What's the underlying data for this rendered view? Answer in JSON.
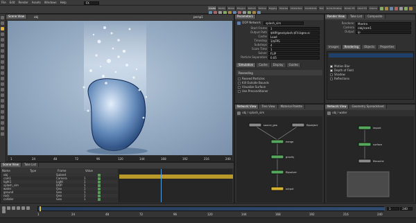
{
  "menu": {
    "items": [
      "File",
      "Edit",
      "Render",
      "Assets",
      "Windows",
      "Help"
    ],
    "desktop": "FX",
    "scene_view_tab": "Scene View",
    "tool_shelf_tabs": [
      "Create",
      "Modify",
      "Model",
      "Polygon",
      "Deform",
      "Texture",
      "Rigging",
      "Muscles",
      "Characters",
      "Constraints",
      "Hair",
      "Guide Brushes",
      "Terrain FX",
      "Cloud FX",
      "Volume"
    ]
  },
  "viewport": {
    "tab_label": "Scene View",
    "path": "obj",
    "camera_label": "persp1",
    "timeline_marks": [
      "1",
      "24",
      "48",
      "72",
      "96",
      "120",
      "144",
      "168",
      "192",
      "216",
      "240"
    ]
  },
  "parameters": {
    "tabs": [
      "Parameters"
    ],
    "node_label": "DOP Network",
    "node_name": "splash_sim",
    "fields": [
      {
        "label": "Start Frame",
        "value": "1"
      },
      {
        "label": "Output Path",
        "value": "$HIP/geo/splash.$F4.bgeo.sc"
      },
      {
        "label": "Cache",
        "value": "Load"
      },
      {
        "label": "Timestep",
        "value": "1/$FPS"
      },
      {
        "label": "Substeps",
        "value": "4"
      },
      {
        "label": "Scale Time",
        "value": "1"
      },
      {
        "label": "Solver",
        "value": "FLIP"
      },
      {
        "label": "Particle Separation",
        "value": "0.05"
      }
    ],
    "subtabs": [
      "Simulation",
      "Cache",
      "Display",
      "Guides"
    ],
    "section_title": "Reseeding",
    "checkboxes": [
      "Reseed Particles",
      "Kill Outside Bounds",
      "Visualize Surface",
      "Use Preconditioner"
    ]
  },
  "render_settings": {
    "tabs": [
      "Render View",
      "Take List",
      "Composite"
    ],
    "rows": [
      {
        "label": "Renderer",
        "value": "Mantra"
      },
      {
        "label": "Camera",
        "value": "/obj/cam1"
      },
      {
        "label": "Output",
        "value": "ip"
      }
    ],
    "tabs2": [
      "Images",
      "Rendering",
      "Objects",
      "Properties"
    ],
    "checkboxes": [
      "Motion Blur",
      "Depth of Field",
      "Shadow",
      "Reflections"
    ]
  },
  "network": {
    "tabs": [
      "Network View",
      "Tree View",
      "Material Palette"
    ],
    "path": "obj / splash_sim",
    "nodes": [
      {
        "label": "source_geo"
      },
      {
        "label": "flipobject"
      },
      {
        "label": "merge"
      },
      {
        "label": "gravity"
      },
      {
        "label": "flipsolver"
      },
      {
        "label": "output"
      }
    ]
  },
  "network2": {
    "tabs": [
      "Network View",
      "Geometry Spreadsheet"
    ],
    "path": "obj / water",
    "nodes": [
      {
        "label": "import"
      },
      {
        "label": "surface"
      },
      {
        "label": "filecache"
      }
    ]
  },
  "outliner": {
    "tabs": [
      "Scene View",
      "Take List"
    ],
    "columns": [
      "Name",
      "Type",
      "Frame",
      "Value"
    ],
    "rows": [
      {
        "name": "obj",
        "type": "Subnet",
        "value": ""
      },
      {
        "name": "cam1",
        "type": "Camera",
        "value": "1"
      },
      {
        "name": "light1",
        "type": "Light",
        "value": "1"
      },
      {
        "name": "splash_sim",
        "type": "DOP",
        "value": "1"
      },
      {
        "name": "water",
        "type": "Geo",
        "value": "1"
      },
      {
        "name": "ground",
        "type": "Geo",
        "value": "1"
      },
      {
        "name": "rock",
        "type": "Geo",
        "value": "1"
      },
      {
        "name": "collider",
        "type": "Geo",
        "value": "1"
      }
    ]
  },
  "timeline": {
    "current_frame": "1",
    "end_frame": "240"
  },
  "colors": {
    "viewport_bg": "#8ea4bc",
    "highlight": "#d9b430",
    "node_green": "#56a85c",
    "node_gray": "#8a8a8a"
  }
}
